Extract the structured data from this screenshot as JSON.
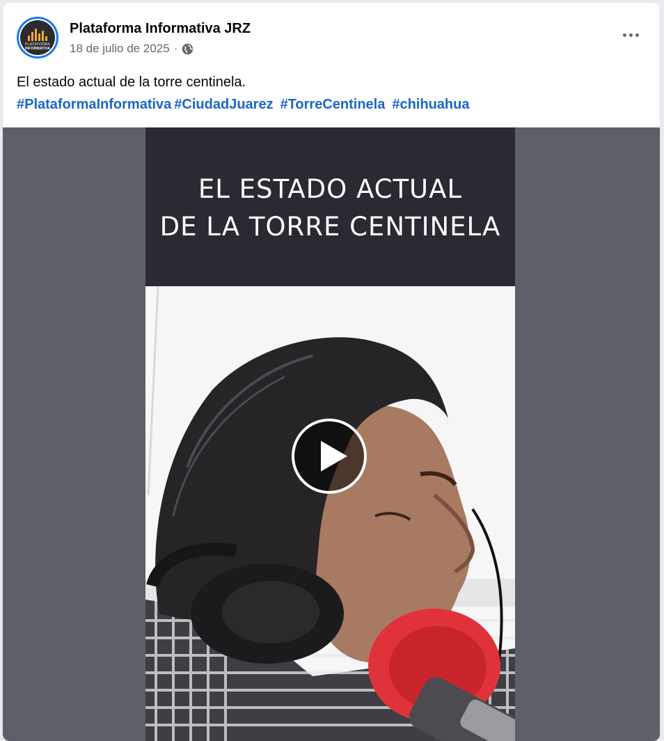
{
  "post": {
    "page_name": "Plataforma Informativa JRZ",
    "date": "18 de julio de 2025",
    "separator": "·",
    "privacy_icon": "globe-icon",
    "more_icon": "more-options-icon",
    "avatar": {
      "brand_line1": "PLATAFORMA",
      "brand_line2": "INFORMATIVA"
    }
  },
  "caption": {
    "text": "El estado actual de la torre centinela.",
    "hashtags": [
      "#PlataformaInformativa",
      "#CiudadJuarez",
      "#TorreCentinela",
      "#chihuahua"
    ]
  },
  "video": {
    "title_line1": "EL ESTADO ACTUAL",
    "title_line2": "DE LA TORRE CENTINELA",
    "play_icon": "play-icon"
  },
  "colors": {
    "hashtag": "#1b66c9",
    "title_band": "#2b2a32",
    "video_background": "#5d6068",
    "avatar_ring": "#1877f2",
    "avatar_bars": "#f2a93b",
    "microphone": "#e0323a"
  }
}
